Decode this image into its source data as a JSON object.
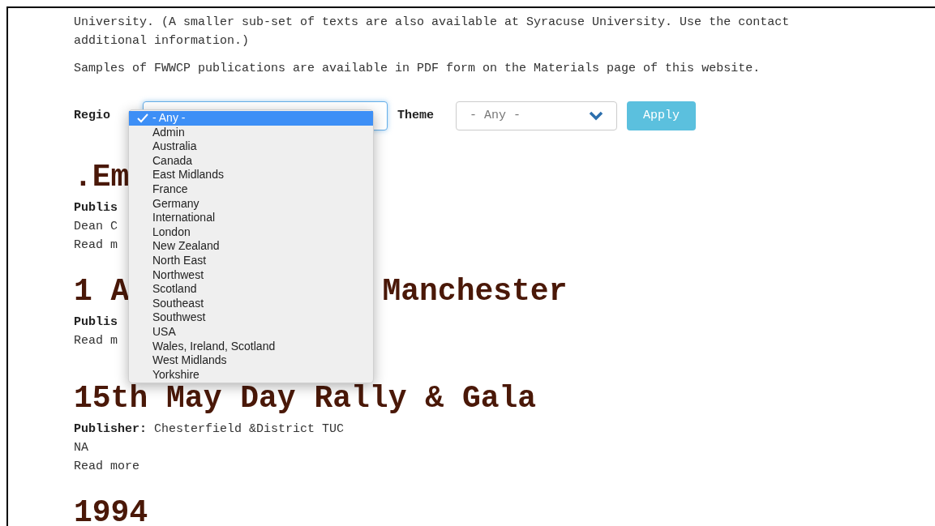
{
  "intro": [
    "University. (A smaller sub-set of texts are also available at Syracuse University. Use the contact",
    "additional information.)"
  ],
  "samples_note": "Samples of FWWCP publications are available in PDF form on the Materials page of this website.",
  "filters": {
    "region_label": "Regio",
    "region_options": [
      {
        "label": "- Any -",
        "selected": true
      },
      {
        "label": "Admin",
        "selected": false
      },
      {
        "label": "Australia",
        "selected": false
      },
      {
        "label": "Canada",
        "selected": false
      },
      {
        "label": "East Midlands",
        "selected": false
      },
      {
        "label": "France",
        "selected": false
      },
      {
        "label": "Germany",
        "selected": false
      },
      {
        "label": "International",
        "selected": false
      },
      {
        "label": "London",
        "selected": false
      },
      {
        "label": "New Zealand",
        "selected": false
      },
      {
        "label": "North East",
        "selected": false
      },
      {
        "label": "Northwest",
        "selected": false
      },
      {
        "label": "Scotland",
        "selected": false
      },
      {
        "label": "Southeast",
        "selected": false
      },
      {
        "label": "Southwest",
        "selected": false
      },
      {
        "label": "USA",
        "selected": false
      },
      {
        "label": "Wales, Ireland, Scotland",
        "selected": false
      },
      {
        "label": "West Midlands",
        "selected": false
      },
      {
        "label": "Yorkshire",
        "selected": false
      }
    ],
    "theme_label": "Theme",
    "theme_value": "- Any -",
    "apply": "Apply"
  },
  "articles": [
    {
      "title": [
        ".Em"
      ],
      "publisher_label": "Publis",
      "details": [
        "Dean C"
      ],
      "read_more": "Read m"
    },
    {
      "title": [
        "1 A",
        "Manchester"
      ],
      "publisher_label": "Publis",
      "read_more": "Read m"
    },
    {
      "title": [
        "15th May Day Rally & Gala"
      ],
      "publisher_label": "Publisher:",
      "publisher": "Chesterfield &District TUC",
      "details": [
        "NA"
      ],
      "read_more": "Read more"
    },
    {
      "title": [
        "1994"
      ]
    }
  ]
}
